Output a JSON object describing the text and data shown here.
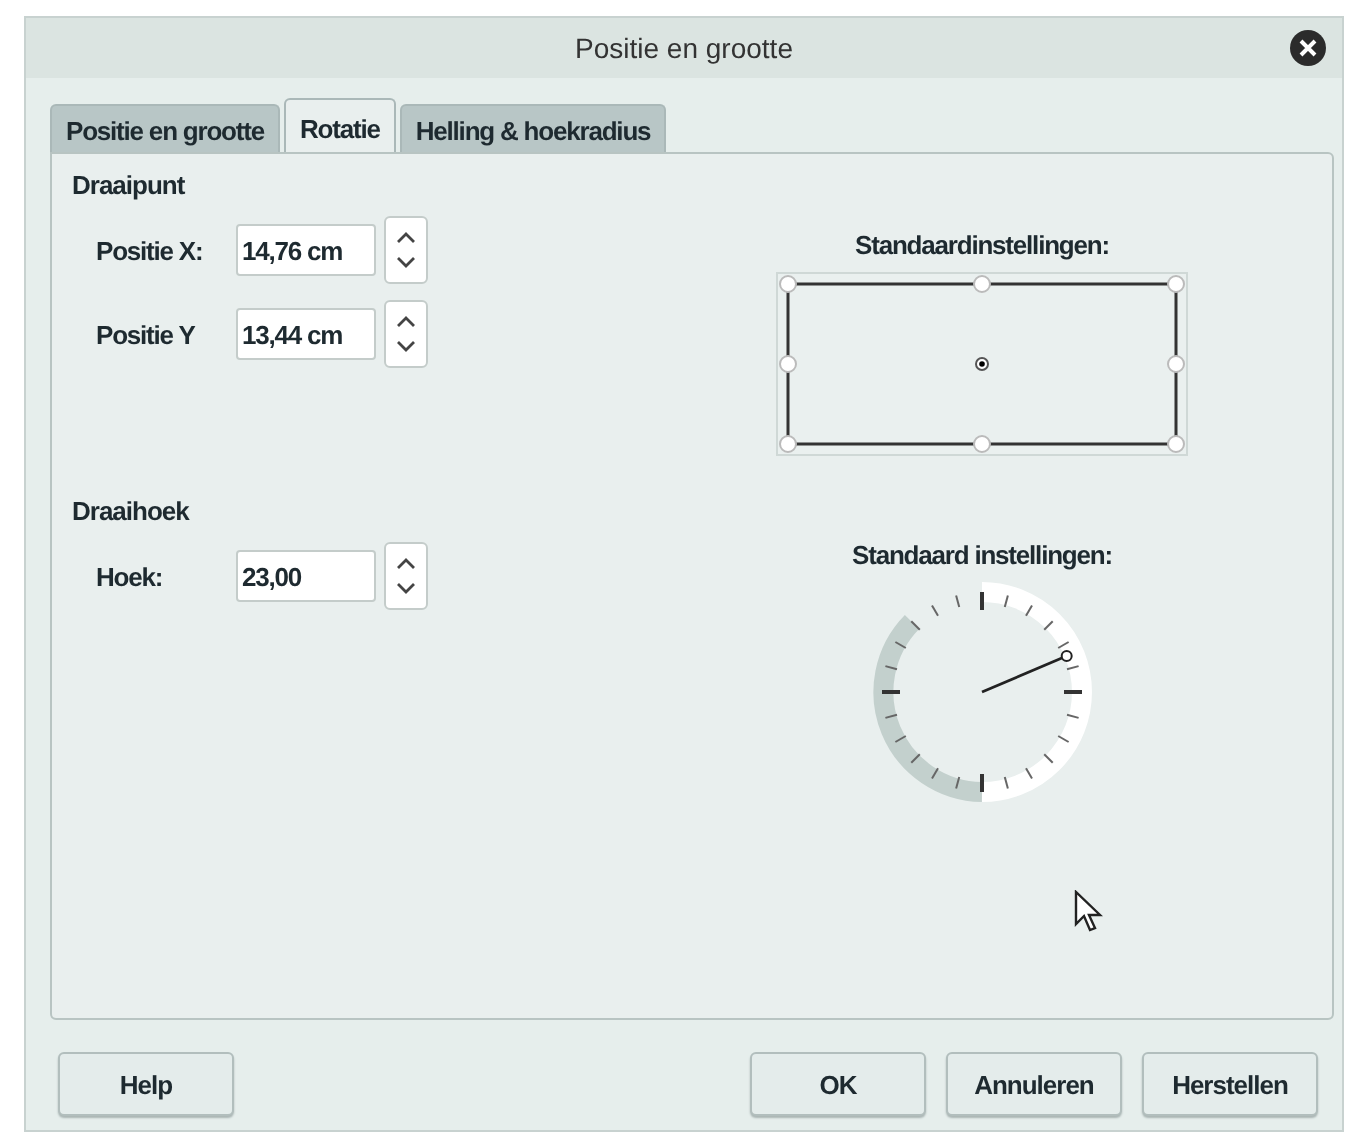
{
  "window": {
    "title": "Positie en grootte"
  },
  "tabs": [
    {
      "label": "Positie en grootte",
      "selected": false
    },
    {
      "label": "Rotatie",
      "selected": true
    },
    {
      "label": "Helling & hoekradius",
      "selected": false
    }
  ],
  "pivot": {
    "heading": "Draaipunt",
    "fields": [
      {
        "label": "Positie X:",
        "value": "14,76 cm"
      },
      {
        "label": "Positie Y",
        "value": "13,44 cm"
      }
    ],
    "preset_label": "Standaardinstellingen:"
  },
  "angle": {
    "heading": "Draaihoek",
    "fields": [
      {
        "label": "Hoek:",
        "value": "23,00"
      }
    ],
    "preset_label": "Standaard instellingen:"
  },
  "buttons": {
    "left": [
      "Help"
    ],
    "right": [
      "OK",
      "Annuleren",
      "Herstellen"
    ]
  }
}
